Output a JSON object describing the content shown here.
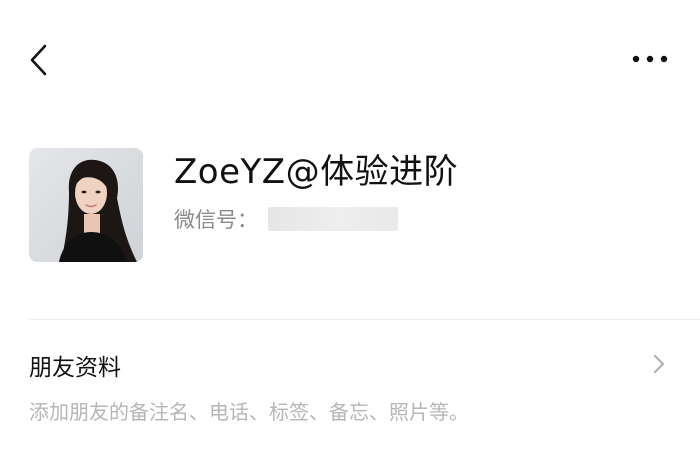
{
  "header": {
    "back_icon": "chevron-left-icon",
    "more_icon": "more-dots-icon"
  },
  "profile": {
    "nickname": "ZoeYZ@体验进阶",
    "wechat_id_label": "微信号：",
    "wechat_id_value": ""
  },
  "friend_info": {
    "title": "朋友资料",
    "description": "添加朋友的备注名、电话、标签、备忘、照片等。",
    "chevron_icon": "chevron-right-icon"
  },
  "colors": {
    "background": "#ffffff",
    "primary_text": "#111111",
    "secondary_text": "#8a8a8a",
    "hint_text": "#b6b6b6",
    "divider": "#ececec"
  }
}
